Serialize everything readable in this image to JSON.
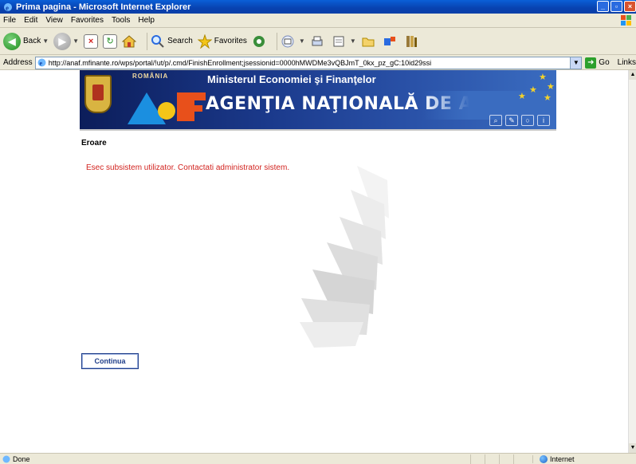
{
  "window": {
    "title": "Prima pagina - Microsoft Internet Explorer",
    "controls": {
      "minimize": "_",
      "maximize": "▫",
      "close": "×"
    }
  },
  "menu": [
    "File",
    "Edit",
    "View",
    "Favorites",
    "Tools",
    "Help"
  ],
  "toolbar": {
    "back_label": "Back",
    "search_label": "Search",
    "favorites_label": "Favorites"
  },
  "address": {
    "label": "Address",
    "url": "http://anaf.mfinante.ro/wps/portal/!ut/p/.cmd/FinishEnrollment;jsessionid=0000hMWDMe3vQBJmT_0kx_pz_gC:10id29ssi",
    "go_label": "Go",
    "links_label": "Links"
  },
  "banner": {
    "country": "ROMÂNIA",
    "ministry": "Ministerul Economiei şi Finanţelor",
    "agency": "AGENŢIA NAŢIONALĂ DE ADMINIS"
  },
  "page": {
    "heading": "Eroare",
    "error_message": "Esec subsistem utilizator. Contactati administrator sistem.",
    "continue_label": "Continua"
  },
  "status": {
    "text": "Done",
    "zone": "Internet"
  },
  "colors": {
    "error": "#d2231f",
    "titlebar": "#0a5fd8",
    "banner": "#1b3a8c"
  }
}
